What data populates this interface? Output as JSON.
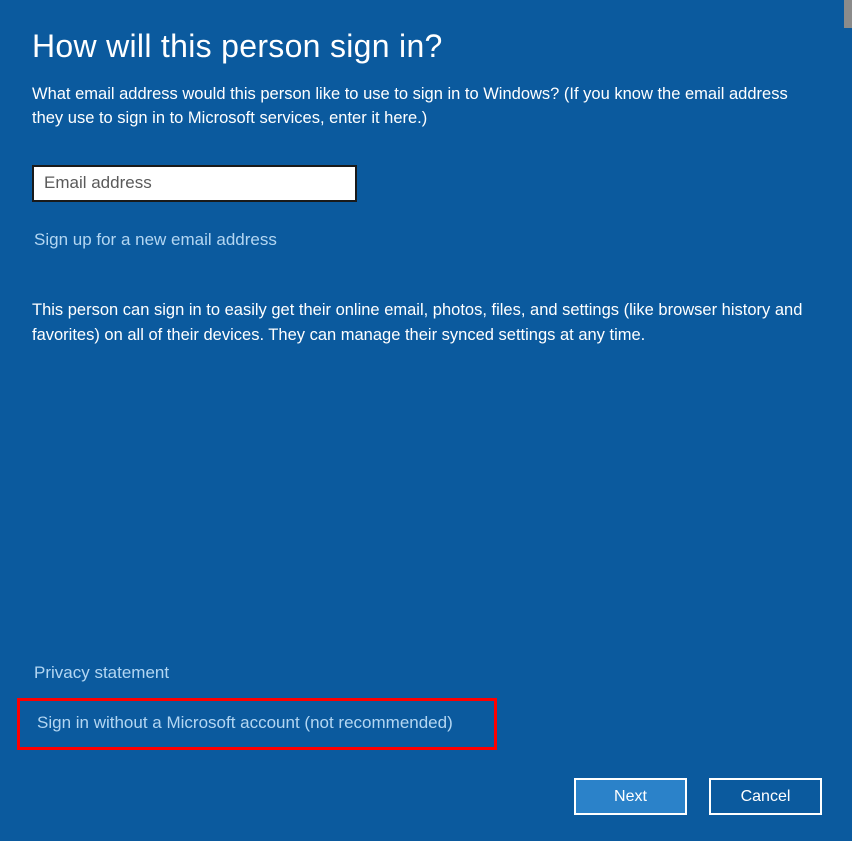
{
  "title": "How will this person sign in?",
  "subtitle": "What email address would this person like to use to sign in to Windows? (If you know the email address they use to sign in to Microsoft services, enter it here.)",
  "email": {
    "value": "",
    "placeholder": "Email address"
  },
  "links": {
    "signup": "Sign up for a new email address",
    "privacy": "Privacy statement",
    "no_account": "Sign in without a Microsoft account (not recommended)"
  },
  "description": "This person can sign in to easily get their online email, photos, files, and settings (like browser history and favorites) on all of their devices. They can manage their synced settings at any time.",
  "buttons": {
    "next": "Next",
    "cancel": "Cancel"
  }
}
